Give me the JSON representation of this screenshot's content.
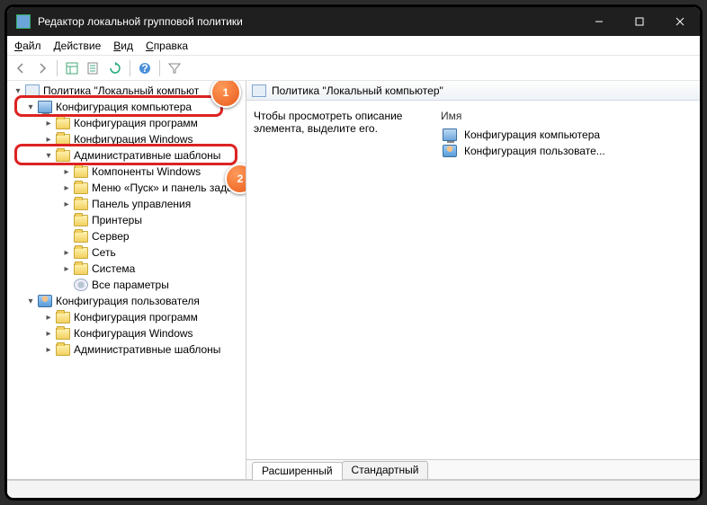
{
  "window": {
    "title": "Редактор локальной групповой политики"
  },
  "menu": {
    "file": "Файл",
    "action": "Действие",
    "view": "Вид",
    "help": "Справка"
  },
  "tree": {
    "root": "Политика \"Локальный компьют",
    "comp_conf": "Конфигурация компьютера",
    "comp_children": {
      "soft": "Конфигурация программ",
      "win": "Конфигурация Windows",
      "admin": "Административные шаблоны",
      "admin_children": [
        "Компоненты Windows",
        "Меню «Пуск» и панель зада",
        "Панель управления",
        "Принтеры",
        "Сервер",
        "Сеть",
        "Система",
        "Все параметры"
      ]
    },
    "user_conf": "Конфигурация пользователя",
    "user_children": [
      "Конфигурация программ",
      "Конфигурация Windows",
      "Административные шаблоны"
    ]
  },
  "detail": {
    "heading": "Политика \"Локальный компьютер\"",
    "hint": "Чтобы просмотреть описание элемента, выделите его.",
    "col_name": "Имя",
    "items": [
      "Конфигурация компьютера",
      "Конфигурация пользовате..."
    ]
  },
  "tabs": {
    "ext": "Расширенный",
    "std": "Стандартный"
  },
  "badges": {
    "one": "1",
    "two": "2"
  }
}
